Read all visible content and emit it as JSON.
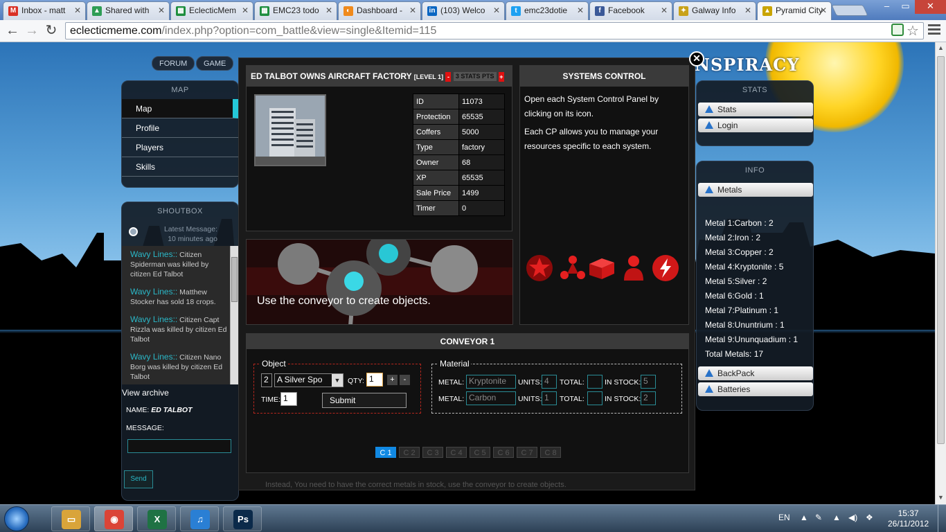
{
  "browser": {
    "tabs": [
      {
        "title": "Inbox - matt",
        "icon": "gmail-icon",
        "color": "#d93025",
        "glyph": "M"
      },
      {
        "title": "Shared with",
        "icon": "drive-icon",
        "color": "#2e9d55",
        "glyph": "▲"
      },
      {
        "title": "EclecticMem",
        "icon": "sheets-icon",
        "color": "#1e8e3e",
        "glyph": "▦"
      },
      {
        "title": "EMC23 todo",
        "icon": "sheets-icon",
        "color": "#1e8e3e",
        "glyph": "▦"
      },
      {
        "title": "Dashboard -",
        "icon": "dashboard-icon",
        "color": "#f08a1c",
        "glyph": "◐"
      },
      {
        "title": "(103) Welco",
        "icon": "linkedin-icon",
        "color": "#0a66c2",
        "glyph": "in"
      },
      {
        "title": "emc23dotie",
        "icon": "twitter-icon",
        "color": "#1da1f2",
        "glyph": "t"
      },
      {
        "title": "Facebook",
        "icon": "facebook-icon",
        "color": "#3b5998",
        "glyph": "f"
      },
      {
        "title": "Galway Info",
        "icon": "galway-icon",
        "color": "#c8a21a",
        "glyph": "✦"
      },
      {
        "title": "Pyramid City",
        "icon": "pyramid-icon",
        "color": "#c9a400",
        "glyph": "▲"
      }
    ],
    "url_host": "eclecticmeme.com",
    "url_path": "/index.php?option=com_battle&view=single&Itemid=115"
  },
  "site": {
    "title_fragment": "NSPIRACY",
    "nav": {
      "forum": "FORUM",
      "game": "GAME"
    },
    "map_panel": {
      "title": "MAP",
      "items": [
        "Map",
        "Profile",
        "Players",
        "Skills"
      ],
      "active": "Map"
    },
    "shoutbox": {
      "title": "SHOUTBOX",
      "latest_label": "Latest Message:",
      "latest_time": "10 minutes ago",
      "messages": [
        {
          "user": "Wavy Lines::",
          "text": "Citizen Spiderman was killed by citizen Ed Talbot"
        },
        {
          "user": "Wavy Lines::",
          "text": "Matthew Stocker has sold 18 crops."
        },
        {
          "user": "Wavy Lines::",
          "text": "Citizen Capt Rizzla was killed by citizen Ed Talbot"
        },
        {
          "user": "Wavy Lines::",
          "text": "Citizen Nano Borg was killed by citizen Ed Talbot"
        }
      ],
      "view_archive": "View archive",
      "name_label": "NAME:",
      "name_value": "ED TALBOT",
      "message_label": "MESSAGE:",
      "message_value": "",
      "send": "Send"
    }
  },
  "modal": {
    "building": {
      "title": "ED TALBOT OWNS AIRCRAFT FACTORY",
      "level": "[LEVEL 1]",
      "minus": "-",
      "stats_pts": "3 STATS PTS",
      "plus": "+",
      "info": [
        {
          "key": "ID",
          "value": "11073"
        },
        {
          "key": "Protection",
          "value": "65535"
        },
        {
          "key": "Coffers",
          "value": "5000"
        },
        {
          "key": "Type",
          "value": "factory"
        },
        {
          "key": "Owner",
          "value": "68"
        },
        {
          "key": "XP",
          "value": "65535"
        },
        {
          "key": "Sale Price",
          "value": "1499"
        },
        {
          "key": "Timer",
          "value": "0"
        }
      ]
    },
    "banner_text": "Use the conveyor to create objects.",
    "systems": {
      "title": "SYSTEMS CONTROL",
      "p1": "Open each System Control Panel by clicking on its icon.",
      "p2": "Each CP allows you to manage your resources specific to each system.",
      "icons": [
        "star-icon",
        "molecule-icon",
        "box-icon",
        "person-icon",
        "lightning-icon"
      ]
    },
    "conveyor": {
      "title": "CONVEYOR 1",
      "object_legend": "Object",
      "object_num": "2",
      "object_select": "A Silver Spo",
      "qty_label": "QTY:",
      "qty_value": "1",
      "plus": "+",
      "minus": "-",
      "time_label": "TIME:",
      "time_value": "1",
      "submit": "Submit",
      "material_legend": "Material",
      "metal_label": "METAL:",
      "units_label": "UNITS:",
      "total_label": "TOTAL:",
      "stock_label": "IN STOCK:",
      "rows": [
        {
          "metal": "Kryptonite",
          "units": "4",
          "total": "",
          "stock": "5"
        },
        {
          "metal": "Carbon",
          "units": "1",
          "total": "",
          "stock": "2"
        }
      ],
      "pages": [
        "C 1",
        "C 2",
        "C 3",
        "C 4",
        "C 5",
        "C 6",
        "C 7",
        "C 8"
      ],
      "active_page": "C 1"
    },
    "footer_hint": "Instead, You need to have the correct metals in stock, use the conveyor to create objects."
  },
  "right": {
    "stats_title": "STATS",
    "stats_buttons": [
      "Stats",
      "Login"
    ],
    "info_title": "INFO",
    "metals_button": "Metals",
    "metals": [
      "Metal 1:Carbon : 2",
      "Metal 2:Iron : 2",
      "Metal 3:Copper : 2",
      "Metal 4:Kryptonite : 5",
      "Metal 5:Silver : 2",
      "Metal 6:Gold : 1",
      "Metal 7:Platinum : 1",
      "Metal 8:Ununtrium : 1",
      "Metal 9:Ununquadium : 1",
      "Total Metals: 17"
    ],
    "more_buttons": [
      "BackPack",
      "Batteries"
    ]
  },
  "taskbar": {
    "apps": [
      {
        "name": "explorer-icon",
        "glyph": "▭",
        "color": "#d9a43a"
      },
      {
        "name": "chrome-icon",
        "glyph": "◉",
        "color": "#db4437"
      },
      {
        "name": "excel-icon",
        "glyph": "X",
        "color": "#1f7244"
      },
      {
        "name": "itunes-icon",
        "glyph": "♫",
        "color": "#2a7fd4"
      },
      {
        "name": "photoshop-icon",
        "glyph": "Ps",
        "color": "#0b2a4a"
      }
    ],
    "lang": "EN",
    "time": "15:37",
    "date": "26/11/2012"
  },
  "colors": {
    "accent": "#24c8d8",
    "link_teal": "#2ab8c8",
    "page_active": "#1189e3",
    "alert_red": "#e01010"
  }
}
